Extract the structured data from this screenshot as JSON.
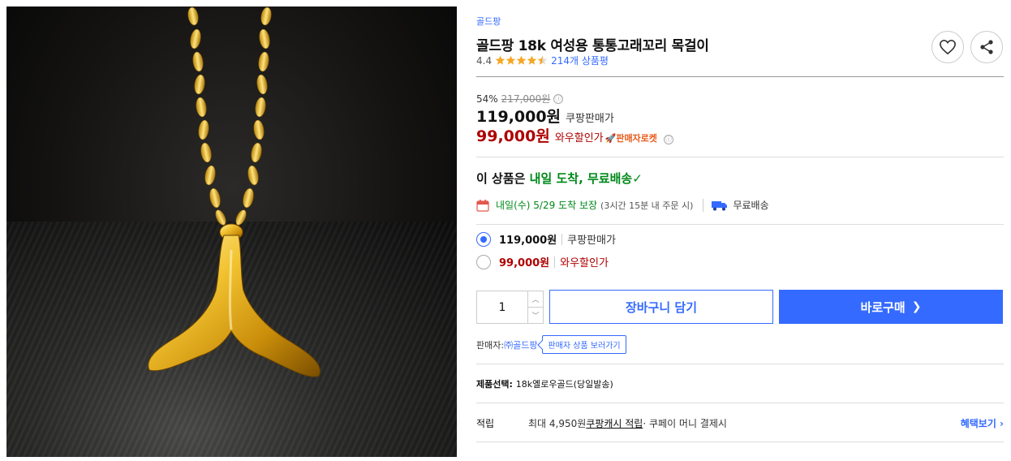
{
  "product": {
    "brand": "골드팡",
    "title": "골드팡 18k 여성용 통통고래꼬리 목걸이",
    "rating": "4.4",
    "rating_value": 4.4,
    "reviews": "214개 상품평",
    "image_icon": "whale-tail-necklace-photo"
  },
  "price": {
    "discount_rate": "54%",
    "original": "217,000원",
    "main": "119,000원",
    "main_label": "쿠팡판매가",
    "wow": "99,000원",
    "wow_label": "와우할인가",
    "rocket_badge": "🚀판매자로켓"
  },
  "delivery": {
    "head_prefix": "이 상품은 ",
    "head_highlight": "내일 도착, 무료배송",
    "arrival": "내일(수) 5/29 도착 보장",
    "order_note": "(3시간 15분 내 주문 시)",
    "free_shipping": "무료배송"
  },
  "options": [
    {
      "price": "119,000원",
      "label": "쿠팡판매가",
      "selected": true
    },
    {
      "price": "99,000원",
      "label": "와우할인가",
      "selected": false
    }
  ],
  "purchase": {
    "quantity": "1",
    "cart_label": "장바구니 담기",
    "buy_label": "바로구매",
    "buy_chevron": "❯"
  },
  "seller": {
    "label": "판매자: ",
    "name": "㈜골드팡",
    "button": "판매자 상품 보러가기"
  },
  "selection": {
    "label": "제품선택: ",
    "value": "18k옐로우골드(당일발송)"
  },
  "points": {
    "label": "적립",
    "prefix": "최대 4,950원 ",
    "link": "쿠팡캐시 적립",
    "suffix": " · 쿠페이 머니 결제시",
    "benefit": "혜택보기 ›"
  },
  "colors": {
    "accent_blue": "#346aff",
    "wow_red": "#ae0000",
    "delivery_green": "#00891a",
    "star_orange": "#f5a623"
  },
  "icons": {
    "heart": "heart-icon",
    "share": "share-icon",
    "info": "ⓘ",
    "calendar": "calendar-icon",
    "truck": "truck-icon",
    "check": "✓",
    "up": "︿",
    "down": "﹀"
  }
}
